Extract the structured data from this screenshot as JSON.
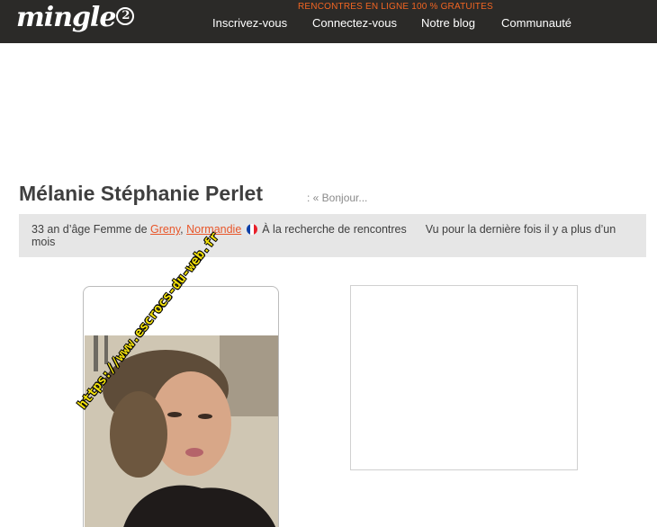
{
  "header": {
    "logo": "mingle",
    "logo_badge": "2",
    "tagline": "RENCONTRES EN LIGNE 100 % GRATUITES",
    "nav": [
      "Inscrivez-vous",
      "Connectez-vous",
      "Notre blog",
      "Communauté"
    ]
  },
  "profile": {
    "name": "Mélanie Stéphanie Perlet",
    "headline": ": « Bonjour...",
    "info_prefix": "33 an d’âge Femme de",
    "city": "Greny",
    "separator": ",",
    "region": "Normandie",
    "looking_for": "À la recherche de rencontres",
    "last_seen": "Vu pour la dernière fois il y a plus d’un mois"
  },
  "photo": {
    "watermark": "https://www.escrocs-du-web.fr"
  },
  "colors": {
    "header_bg": "#2b2a28",
    "accent": "#f26522",
    "link": "#e8562a",
    "info_bg": "#e6e6e6"
  }
}
